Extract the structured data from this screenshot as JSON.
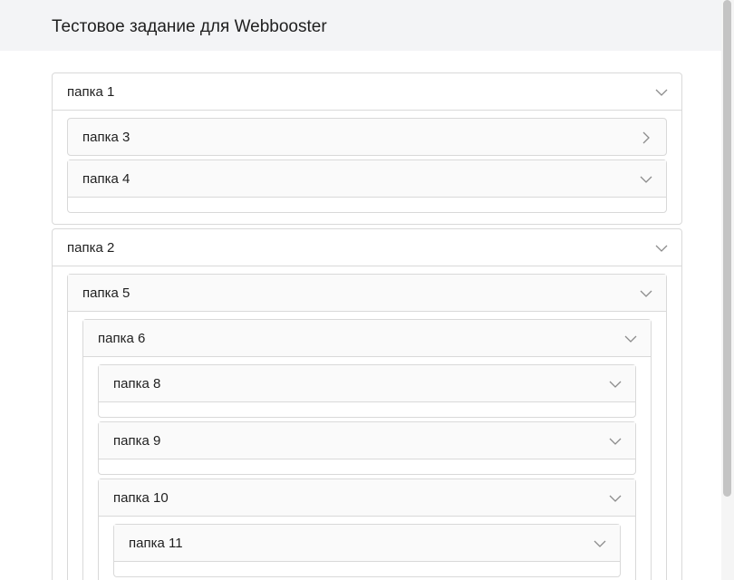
{
  "header": {
    "title": "Тестовое задание для Webbooster"
  },
  "tree": {
    "folder1": {
      "label": "папка 1",
      "expanded": true,
      "icon": "chevron-down-icon"
    },
    "folder3": {
      "label": "папка 3",
      "expanded": false,
      "icon": "chevron-right-icon"
    },
    "folder4": {
      "label": "папка 4",
      "expanded": true,
      "icon": "chevron-down-icon"
    },
    "folder2": {
      "label": "папка 2",
      "expanded": true,
      "icon": "chevron-down-icon"
    },
    "folder5": {
      "label": "папка 5",
      "expanded": true,
      "icon": "chevron-down-icon"
    },
    "folder6": {
      "label": "папка 6",
      "expanded": true,
      "icon": "chevron-down-icon"
    },
    "folder8": {
      "label": "папка 8",
      "expanded": true,
      "icon": "chevron-down-icon"
    },
    "folder9": {
      "label": "папка 9",
      "expanded": true,
      "icon": "chevron-down-icon"
    },
    "folder10": {
      "label": "папка 10",
      "expanded": true,
      "icon": "chevron-down-icon"
    },
    "folder11": {
      "label": "папка 11",
      "expanded": true,
      "icon": "chevron-down-icon"
    }
  }
}
